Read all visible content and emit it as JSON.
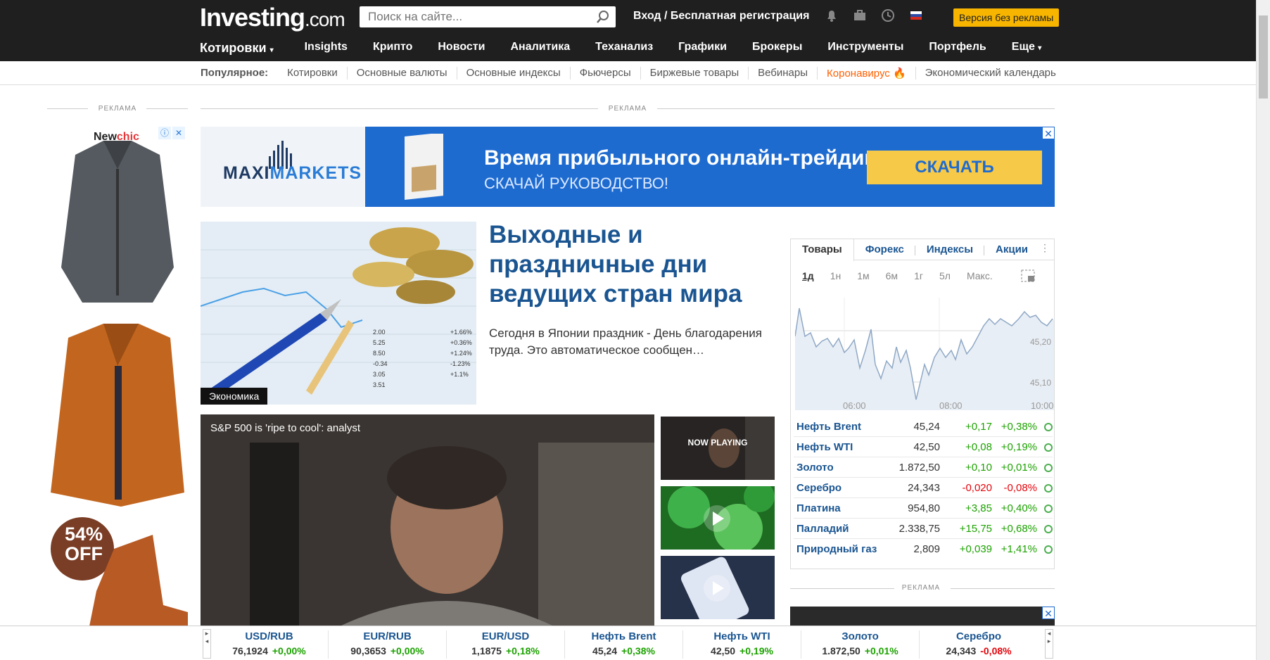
{
  "header": {
    "logo_main": "Investing",
    "logo_suffix": ".com",
    "search_placeholder": "Поиск на сайте...",
    "login_text": "Вход / Бесплатная регистрация",
    "noad_button": "Версия без рекламы"
  },
  "nav": {
    "items": [
      "Котировки",
      "Insights",
      "Крипто",
      "Новости",
      "Аналитика",
      "Теханализ",
      "Графики",
      "Брокеры",
      "Инструменты",
      "Портфель",
      "Еще"
    ]
  },
  "popular": {
    "label": "Популярное:",
    "items": [
      "Котировки",
      "Основные валюты",
      "Основные индексы",
      "Фьючерсы",
      "Биржевые товары",
      "Вебинары",
      "Коронавирус",
      "Экономический календарь"
    ]
  },
  "ads": {
    "label": "РЕКЛАМА",
    "left_brand_a": "New",
    "left_brand_b": "chic",
    "left_discount": "54%",
    "left_discount_off": "OFF",
    "banner_brand_a": "MAXI",
    "banner_brand_b": "MARKETS",
    "banner_title": "Время прибыльного онлайн-трейдинга",
    "banner_sub": "СКАЧАЙ РУКОВОДСТВО!",
    "banner_cta": "СКАЧАТЬ",
    "close": "✕"
  },
  "article": {
    "tag": "Экономика",
    "title": "Выходные и праздничные дни ведущих стран мира",
    "text": "Сегодня в Японии праздник - День благодарения труда. Это автоматическое сообщен…"
  },
  "video": {
    "title": "S&P 500 is 'ripe to cool': analyst",
    "now_playing": "NOW PLAYING"
  },
  "widget": {
    "tabs": [
      "Товары",
      "Форекс",
      "Индексы",
      "Акции"
    ],
    "periods": [
      "1д",
      "1н",
      "1м",
      "6м",
      "1г",
      "5л",
      "Макс."
    ],
    "chart_ylabels": [
      "45,20",
      "45,10"
    ],
    "chart_xlabels": [
      "06:00",
      "08:00",
      "10:00"
    ],
    "rows": [
      {
        "name": "Нефть Brent",
        "last": "45,24",
        "chg": "+0,17",
        "pct": "+0,38%",
        "dir": "pos"
      },
      {
        "name": "Нефть WTI",
        "last": "42,50",
        "chg": "+0,08",
        "pct": "+0,19%",
        "dir": "pos"
      },
      {
        "name": "Золото",
        "last": "1.872,50",
        "chg": "+0,10",
        "pct": "+0,01%",
        "dir": "pos"
      },
      {
        "name": "Серебро",
        "last": "24,343",
        "chg": "-0,020",
        "pct": "-0,08%",
        "dir": "neg"
      },
      {
        "name": "Платина",
        "last": "954,80",
        "chg": "+3,85",
        "pct": "+0,40%",
        "dir": "pos"
      },
      {
        "name": "Палладий",
        "last": "2.338,75",
        "chg": "+15,75",
        "pct": "+0,68%",
        "dir": "pos"
      },
      {
        "name": "Природный газ",
        "last": "2,809",
        "chg": "+0,039",
        "pct": "+1,41%",
        "dir": "pos"
      }
    ]
  },
  "ticker": [
    {
      "name": "USD/RUB",
      "value": "76,1924",
      "pct": "+0,00%",
      "dir": "pos"
    },
    {
      "name": "EUR/RUB",
      "value": "90,3653",
      "pct": "+0,00%",
      "dir": "pos"
    },
    {
      "name": "EUR/USD",
      "value": "1,1875",
      "pct": "+0,18%",
      "dir": "pos"
    },
    {
      "name": "Нефть Brent",
      "value": "45,24",
      "pct": "+0,38%",
      "dir": "pos"
    },
    {
      "name": "Нефть WTI",
      "value": "42,50",
      "pct": "+0,19%",
      "dir": "pos"
    },
    {
      "name": "Золото",
      "value": "1.872,50",
      "pct": "+0,01%",
      "dir": "pos"
    },
    {
      "name": "Серебро",
      "value": "24,343",
      "pct": "-0,08%",
      "dir": "neg"
    }
  ],
  "colors": {
    "brand_blue": "#1a5591",
    "positive": "#1ca200",
    "negative": "#e4050c",
    "accent_yellow": "#f7b500",
    "hot": "#ff5f00"
  }
}
